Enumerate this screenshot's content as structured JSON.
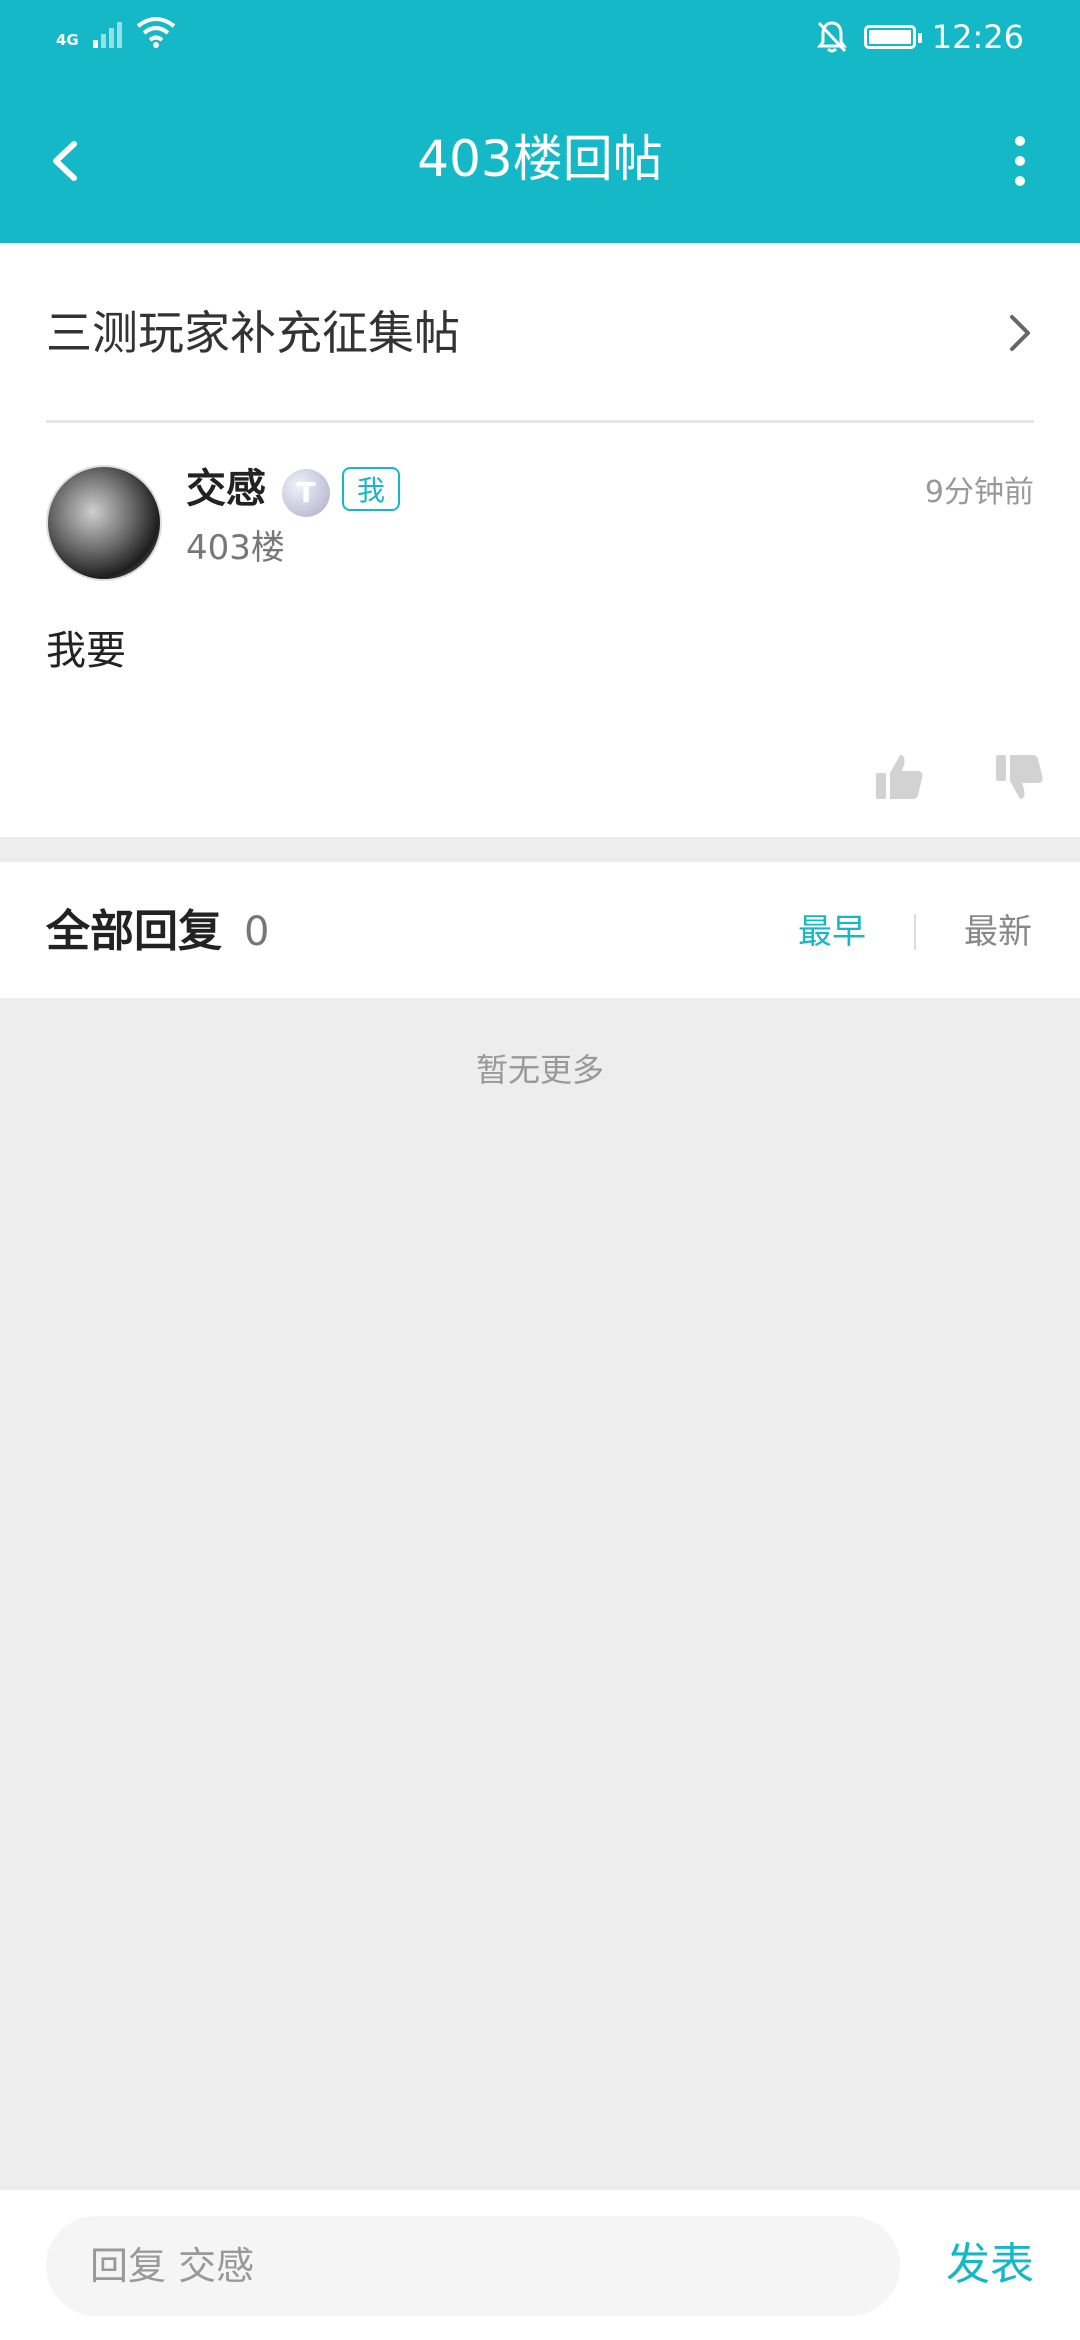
{
  "status_bar": {
    "network": "4G",
    "time": "12:26",
    "icons": [
      "signal-icon",
      "wifi-icon",
      "notifications-off-icon",
      "battery-icon"
    ]
  },
  "app_bar": {
    "title": "403楼回帖",
    "back_icon": "chevron-left-icon",
    "more_icon": "more-vertical-icon"
  },
  "thread": {
    "title": "三测玩家补充征集帖",
    "arrow_icon": "chevron-right-icon"
  },
  "post": {
    "username": "交感",
    "level_badge": "T",
    "me_tag": "我",
    "floor": "403楼",
    "time": "9分钟前",
    "content": "我要",
    "actions": [
      "thumbs-up-icon",
      "thumbs-down-icon"
    ]
  },
  "replies": {
    "title": "全部回复",
    "count": "0",
    "sort_earliest": "最早",
    "sort_newest": "最新",
    "empty_text": "暂无更多"
  },
  "composer": {
    "placeholder": "回复 交感",
    "send_label": "发表"
  },
  "colors": {
    "accent": "#15b8c7",
    "page_background": "#ededed"
  }
}
